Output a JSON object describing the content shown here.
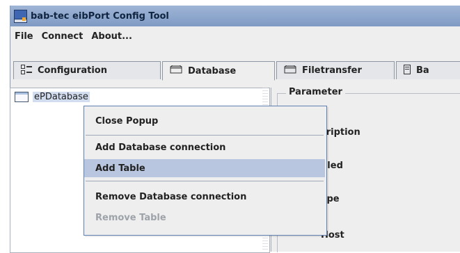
{
  "window": {
    "title": "bab-tec eibPort Config Tool"
  },
  "menu": {
    "items": [
      "File",
      "Connect",
      "About..."
    ]
  },
  "tabs": [
    {
      "label": "Configuration",
      "icon": "configuration-icon"
    },
    {
      "label": "Database",
      "icon": "database-icon"
    },
    {
      "label": "Filetransfer",
      "icon": "filetransfer-icon"
    },
    {
      "label": "Ba",
      "icon": "backup-icon"
    }
  ],
  "tree": {
    "root": "ePDatabase"
  },
  "parameter": {
    "title": "Parameter",
    "labels": [
      "cription",
      "bled",
      "ype",
      "Host"
    ]
  },
  "popup": {
    "items": [
      {
        "label": "Close Popup",
        "enabled": true
      },
      {
        "label": "Add Database connection",
        "enabled": true
      },
      {
        "label": "Add Table",
        "enabled": true,
        "highlighted": true
      },
      {
        "label": "Remove Database connection",
        "enabled": true
      },
      {
        "label": "Remove Table",
        "enabled": false
      }
    ]
  },
  "colors": {
    "titlebar": "#8fa8cf",
    "popup_highlight": "#b8c7df",
    "selection": "#d3ddf0",
    "disabled_text": "#9ea3aa"
  }
}
